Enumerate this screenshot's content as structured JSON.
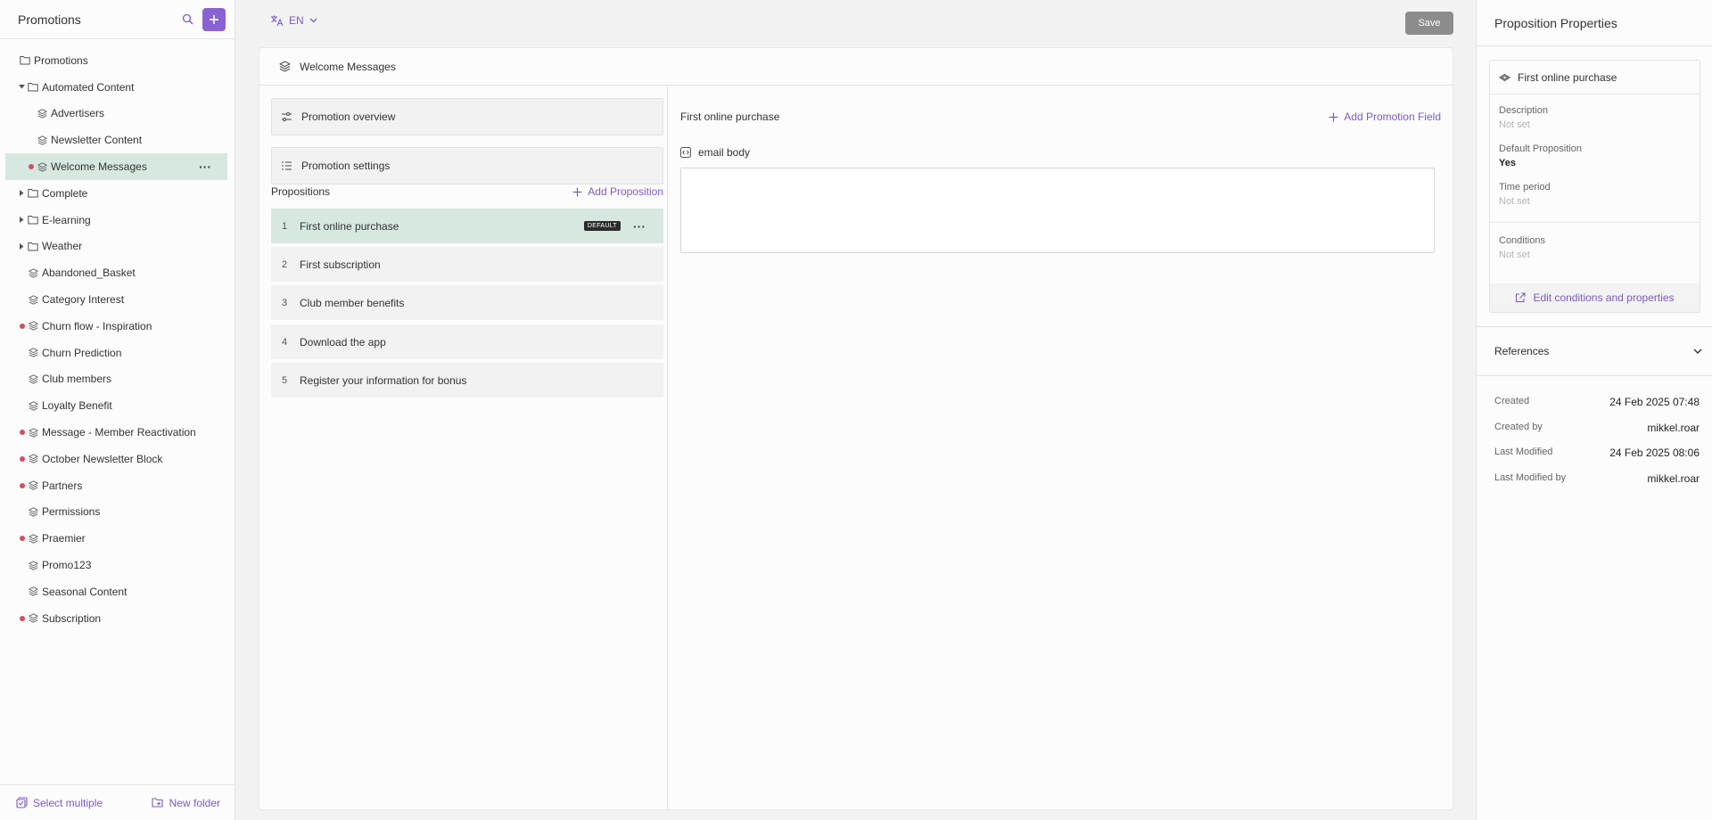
{
  "sidebar": {
    "title": "Promotions",
    "tree": [
      {
        "label": "Promotions",
        "kind": "folder",
        "level": 0,
        "dot": false,
        "caret": ""
      },
      {
        "label": "Automated Content",
        "kind": "folder",
        "level": 1,
        "dot": false,
        "caret": "down"
      },
      {
        "label": "Advertisers",
        "kind": "stack",
        "level": 2,
        "dot": false,
        "caret": ""
      },
      {
        "label": "Newsletter Content",
        "kind": "stack",
        "level": 2,
        "dot": false,
        "caret": ""
      },
      {
        "label": "Welcome Messages",
        "kind": "stack",
        "level": 2,
        "dot": true,
        "caret": "",
        "selected": true
      },
      {
        "label": "Complete",
        "kind": "folder",
        "level": 1,
        "dot": false,
        "caret": "right"
      },
      {
        "label": "E-learning",
        "kind": "folder",
        "level": 1,
        "dot": false,
        "caret": "right"
      },
      {
        "label": "Weather",
        "kind": "folder",
        "level": 1,
        "dot": false,
        "caret": "right"
      },
      {
        "label": "Abandoned_Basket",
        "kind": "stack",
        "level": 1,
        "dot": false,
        "caret": ""
      },
      {
        "label": "Category Interest",
        "kind": "stack",
        "level": 1,
        "dot": false,
        "caret": ""
      },
      {
        "label": "Churn flow - Inspiration",
        "kind": "stack",
        "level": 1,
        "dot": true,
        "caret": ""
      },
      {
        "label": "Churn Prediction",
        "kind": "stack",
        "level": 1,
        "dot": false,
        "caret": ""
      },
      {
        "label": "Club members",
        "kind": "stack",
        "level": 1,
        "dot": false,
        "caret": ""
      },
      {
        "label": "Loyalty Benefit",
        "kind": "stack",
        "level": 1,
        "dot": false,
        "caret": ""
      },
      {
        "label": "Message - Member Reactivation",
        "kind": "stack",
        "level": 1,
        "dot": true,
        "caret": ""
      },
      {
        "label": "October Newsletter Block",
        "kind": "stack",
        "level": 1,
        "dot": true,
        "caret": ""
      },
      {
        "label": "Partners",
        "kind": "stack",
        "level": 1,
        "dot": true,
        "caret": ""
      },
      {
        "label": "Permissions",
        "kind": "stack",
        "level": 1,
        "dot": false,
        "caret": ""
      },
      {
        "label": "Praemier",
        "kind": "stack",
        "level": 1,
        "dot": true,
        "caret": ""
      },
      {
        "label": "Promo123",
        "kind": "stack",
        "level": 1,
        "dot": false,
        "caret": ""
      },
      {
        "label": "Seasonal Content",
        "kind": "stack",
        "level": 1,
        "dot": false,
        "caret": ""
      },
      {
        "label": "Subscription",
        "kind": "stack",
        "level": 1,
        "dot": true,
        "caret": ""
      }
    ],
    "footer": {
      "select_multiple": "Select multiple",
      "new_folder": "New folder"
    }
  },
  "topbar": {
    "language": "EN",
    "save_label": "Save"
  },
  "editor": {
    "header_title": "Welcome Messages",
    "overview_label": "Promotion overview",
    "settings_label": "Promotion settings",
    "propositions_title": "Propositions",
    "add_proposition": "Add Proposition",
    "propositions": [
      {
        "num": "1",
        "label": "First online purchase",
        "badge": "DEFAULT",
        "selected": true
      },
      {
        "num": "2",
        "label": "First subscription",
        "badge": "",
        "selected": false
      },
      {
        "num": "3",
        "label": "Club member benefits",
        "badge": "",
        "selected": false
      },
      {
        "num": "4",
        "label": "Download the app",
        "badge": "",
        "selected": false
      },
      {
        "num": "5",
        "label": "Register your information for bonus",
        "badge": "",
        "selected": false
      }
    ],
    "field_panel_title": "First online purchase",
    "add_field": "Add Promotion Field",
    "field_label": "email body",
    "field_value": ""
  },
  "properties": {
    "title": "Proposition Properties",
    "card_title": "First online purchase",
    "description_label": "Description",
    "description_value": "Not set",
    "default_label": "Default Proposition",
    "default_value": "Yes",
    "time_label": "Time period",
    "time_value": "Not set",
    "conditions_label": "Conditions",
    "conditions_value": "Not set",
    "edit_label": "Edit conditions and properties",
    "references_label": "References",
    "meta": [
      {
        "k": "Created",
        "v": "24 Feb 2025 07:48"
      },
      {
        "k": "Created by",
        "v": "mikkel.roar"
      },
      {
        "k": "Last Modified",
        "v": "24 Feb 2025 08:06"
      },
      {
        "k": "Last Modified by",
        "v": "mikkel.roar"
      }
    ]
  },
  "colors": {
    "accent": "#8a63d2",
    "selected": "#d7e8e1",
    "status_dot": "#d34e5e",
    "save_disabled": "#8c8c8c"
  }
}
